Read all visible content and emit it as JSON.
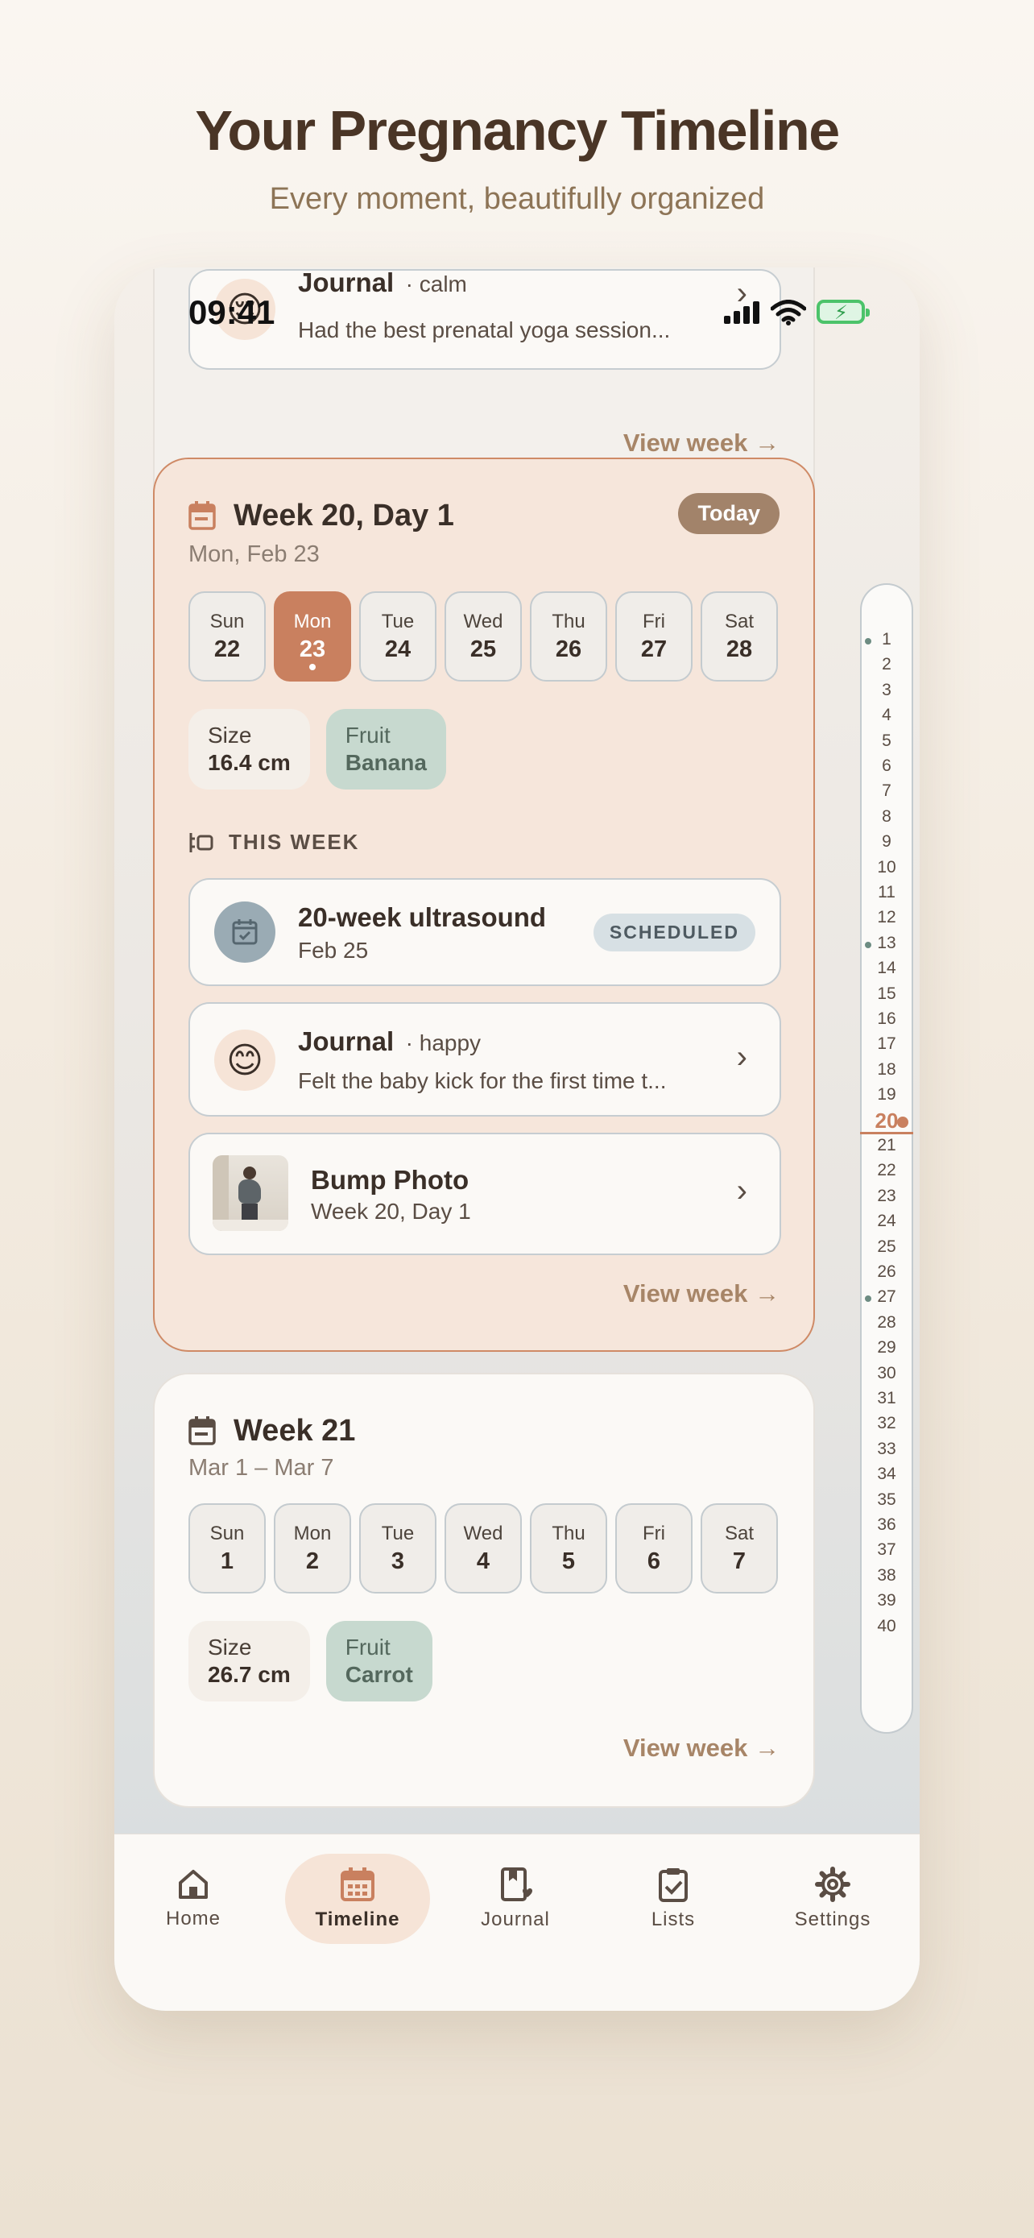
{
  "hero": {
    "title": "Your Pregnancy Timeline",
    "subtitle": "Every moment, beautifully organized"
  },
  "status_bar": {
    "time": "09:41"
  },
  "previous_week": {
    "journal_title": "Journal",
    "journal_mood": "· calm",
    "journal_excerpt": "Had the best prenatal yoga session...",
    "view_week": "View week →"
  },
  "current_week": {
    "title": "Week 20, Day 1",
    "date": "Mon, Feb 23",
    "badge": "Today",
    "days": [
      {
        "name": "Sun",
        "num": "22"
      },
      {
        "name": "Mon",
        "num": "23"
      },
      {
        "name": "Tue",
        "num": "24"
      },
      {
        "name": "Wed",
        "num": "25"
      },
      {
        "name": "Thu",
        "num": "26"
      },
      {
        "name": "Fri",
        "num": "27"
      },
      {
        "name": "Sat",
        "num": "28"
      }
    ],
    "selected_day": "Mon",
    "size_label": "Size",
    "size_value": "16.4 cm",
    "fruit_label": "Fruit",
    "fruit_value": "Banana",
    "section_label": "THIS WEEK",
    "appointment": {
      "title": "20-week ultrasound",
      "date": "Feb 25",
      "status": "SCHEDULED"
    },
    "journal": {
      "title": "Journal",
      "mood": "· happy",
      "excerpt": "Felt the baby kick for the first time t..."
    },
    "bump_photo": {
      "title": "Bump Photo",
      "subtitle": "Week 20, Day 1"
    },
    "view_week": "View week →"
  },
  "next_week": {
    "title": "Week 21",
    "date": "Mar 1 – Mar 7",
    "days": [
      {
        "name": "Sun",
        "num": "1"
      },
      {
        "name": "Mon",
        "num": "2"
      },
      {
        "name": "Tue",
        "num": "3"
      },
      {
        "name": "Wed",
        "num": "4"
      },
      {
        "name": "Thu",
        "num": "5"
      },
      {
        "name": "Fri",
        "num": "6"
      },
      {
        "name": "Sat",
        "num": "7"
      }
    ],
    "size_label": "Size",
    "size_value": "26.7 cm",
    "fruit_label": "Fruit",
    "fruit_value": "Carrot",
    "view_week": "View week →"
  },
  "week_rail": {
    "weeks": [
      "1",
      "2",
      "3",
      "4",
      "5",
      "6",
      "7",
      "8",
      "9",
      "10",
      "11",
      "12",
      "13",
      "14",
      "15",
      "16",
      "17",
      "18",
      "19",
      "20",
      "21",
      "22",
      "23",
      "24",
      "25",
      "26",
      "27",
      "28",
      "29",
      "30",
      "31",
      "32",
      "33",
      "34",
      "35",
      "36",
      "37",
      "38",
      "39",
      "40"
    ],
    "current": "20",
    "marked": [
      "1",
      "13",
      "27"
    ]
  },
  "tabs": [
    {
      "label": "Home",
      "icon": "home-icon"
    },
    {
      "label": "Timeline",
      "icon": "calendar-icon"
    },
    {
      "label": "Journal",
      "icon": "journal-icon"
    },
    {
      "label": "Lists",
      "icon": "clipboard-check-icon"
    },
    {
      "label": "Settings",
      "icon": "gear-icon"
    }
  ],
  "active_tab": "Timeline",
  "colors": {
    "accent": "#c9805f",
    "badge": "#a2836a",
    "fruit_chip": "#c7d9cf",
    "current_card": "#f6e6db"
  }
}
